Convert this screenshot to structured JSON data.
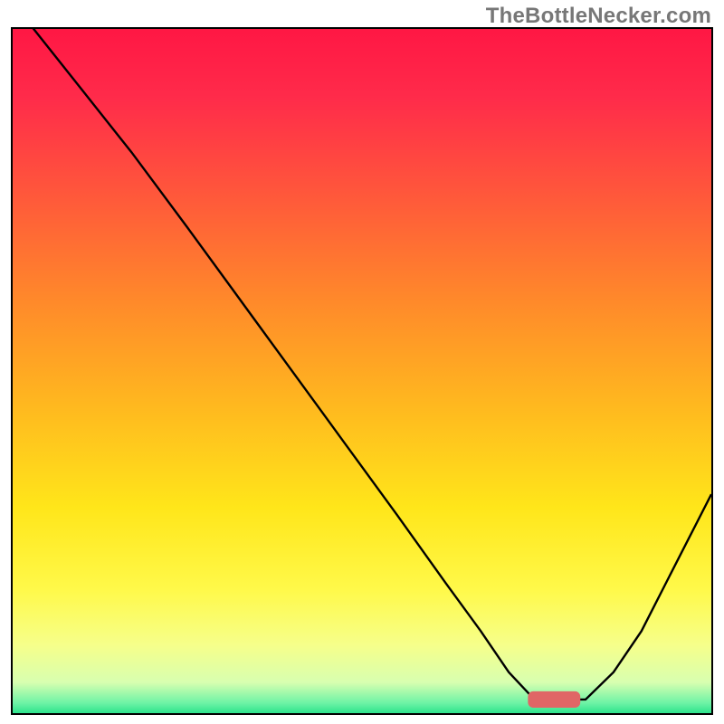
{
  "watermark": "TheBottleNecker.com",
  "chart_data": {
    "type": "line",
    "title": "",
    "xlabel": "",
    "ylabel": "",
    "xlim": [
      0,
      100
    ],
    "ylim": [
      0,
      100
    ],
    "gradient_stops": [
      {
        "offset": 0.0,
        "color": "#ff1744"
      },
      {
        "offset": 0.1,
        "color": "#ff2b4a"
      },
      {
        "offset": 0.25,
        "color": "#ff5a3a"
      },
      {
        "offset": 0.4,
        "color": "#ff8a2a"
      },
      {
        "offset": 0.55,
        "color": "#ffb81f"
      },
      {
        "offset": 0.7,
        "color": "#ffe61a"
      },
      {
        "offset": 0.82,
        "color": "#fff94a"
      },
      {
        "offset": 0.9,
        "color": "#f6ff8a"
      },
      {
        "offset": 0.955,
        "color": "#d8ffb0"
      },
      {
        "offset": 0.985,
        "color": "#6ef3a6"
      },
      {
        "offset": 1.0,
        "color": "#2de38c"
      }
    ],
    "series": [
      {
        "name": "bottleneck-curve",
        "x": [
          0,
          3,
          10,
          17,
          25,
          35,
          45,
          55,
          62,
          67,
          71,
          74.5,
          79,
          82,
          86,
          90,
          94,
          98,
          100
        ],
        "values": [
          104,
          100,
          91,
          82,
          71,
          57,
          43,
          29,
          19,
          12,
          6,
          2.2,
          2,
          2,
          6,
          12,
          20,
          28,
          32
        ]
      }
    ],
    "marker": {
      "name": "optimal-zone",
      "shape": "rounded-rect",
      "x_center": 77.5,
      "y_center": 2.0,
      "width": 7.5,
      "height": 2.4,
      "color": "#e06666"
    }
  }
}
